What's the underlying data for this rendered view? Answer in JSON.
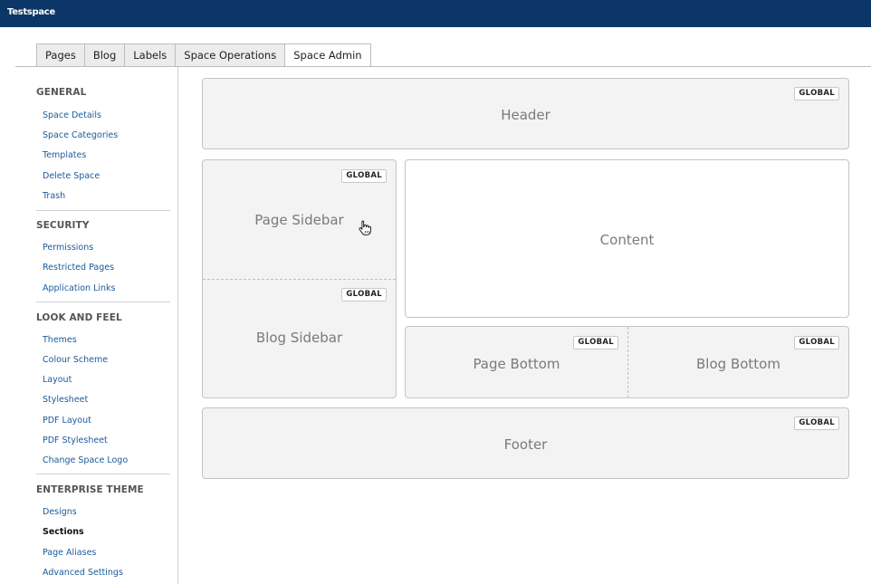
{
  "app": {
    "title": "Testspace"
  },
  "tabs": [
    {
      "label": "Pages"
    },
    {
      "label": "Blog"
    },
    {
      "label": "Labels"
    },
    {
      "label": "Space Operations"
    },
    {
      "label": "Space Admin",
      "active": true
    }
  ],
  "sidebar": {
    "general": {
      "title": "GENERAL",
      "items": [
        "Space Details",
        "Space Categories",
        "Templates",
        "Delete Space",
        "Trash"
      ]
    },
    "security": {
      "title": "SECURITY",
      "items": [
        "Permissions",
        "Restricted Pages",
        "Application Links"
      ]
    },
    "look_and_feel": {
      "title": "LOOK AND FEEL",
      "items": [
        "Themes",
        "Colour Scheme",
        "Layout",
        "Stylesheet",
        "PDF Layout",
        "PDF Stylesheet",
        "Change Space Logo"
      ]
    },
    "enterprise_theme": {
      "title": "ENTERPRISE THEME",
      "items": [
        "Designs",
        "Sections",
        "Page Aliases",
        "Advanced Settings"
      ],
      "current": "Sections"
    }
  },
  "layout": {
    "header": {
      "label": "Header",
      "badge": "GLOBAL"
    },
    "page_sidebar": {
      "label": "Page Sidebar",
      "badge": "GLOBAL"
    },
    "blog_sidebar": {
      "label": "Blog Sidebar",
      "badge": "GLOBAL"
    },
    "content": {
      "label": "Content"
    },
    "page_bottom": {
      "label": "Page Bottom",
      "badge": "GLOBAL"
    },
    "blog_bottom": {
      "label": "Blog Bottom",
      "badge": "GLOBAL"
    },
    "footer": {
      "label": "Footer",
      "badge": "GLOBAL"
    }
  },
  "colors": {
    "topbar": "#0c3667",
    "link": "#1a5a9c",
    "panel_bg": "#f3f3f3",
    "panel_border": "#c4c4c4"
  },
  "icons": {
    "cursor": "hand-pointer-icon"
  }
}
